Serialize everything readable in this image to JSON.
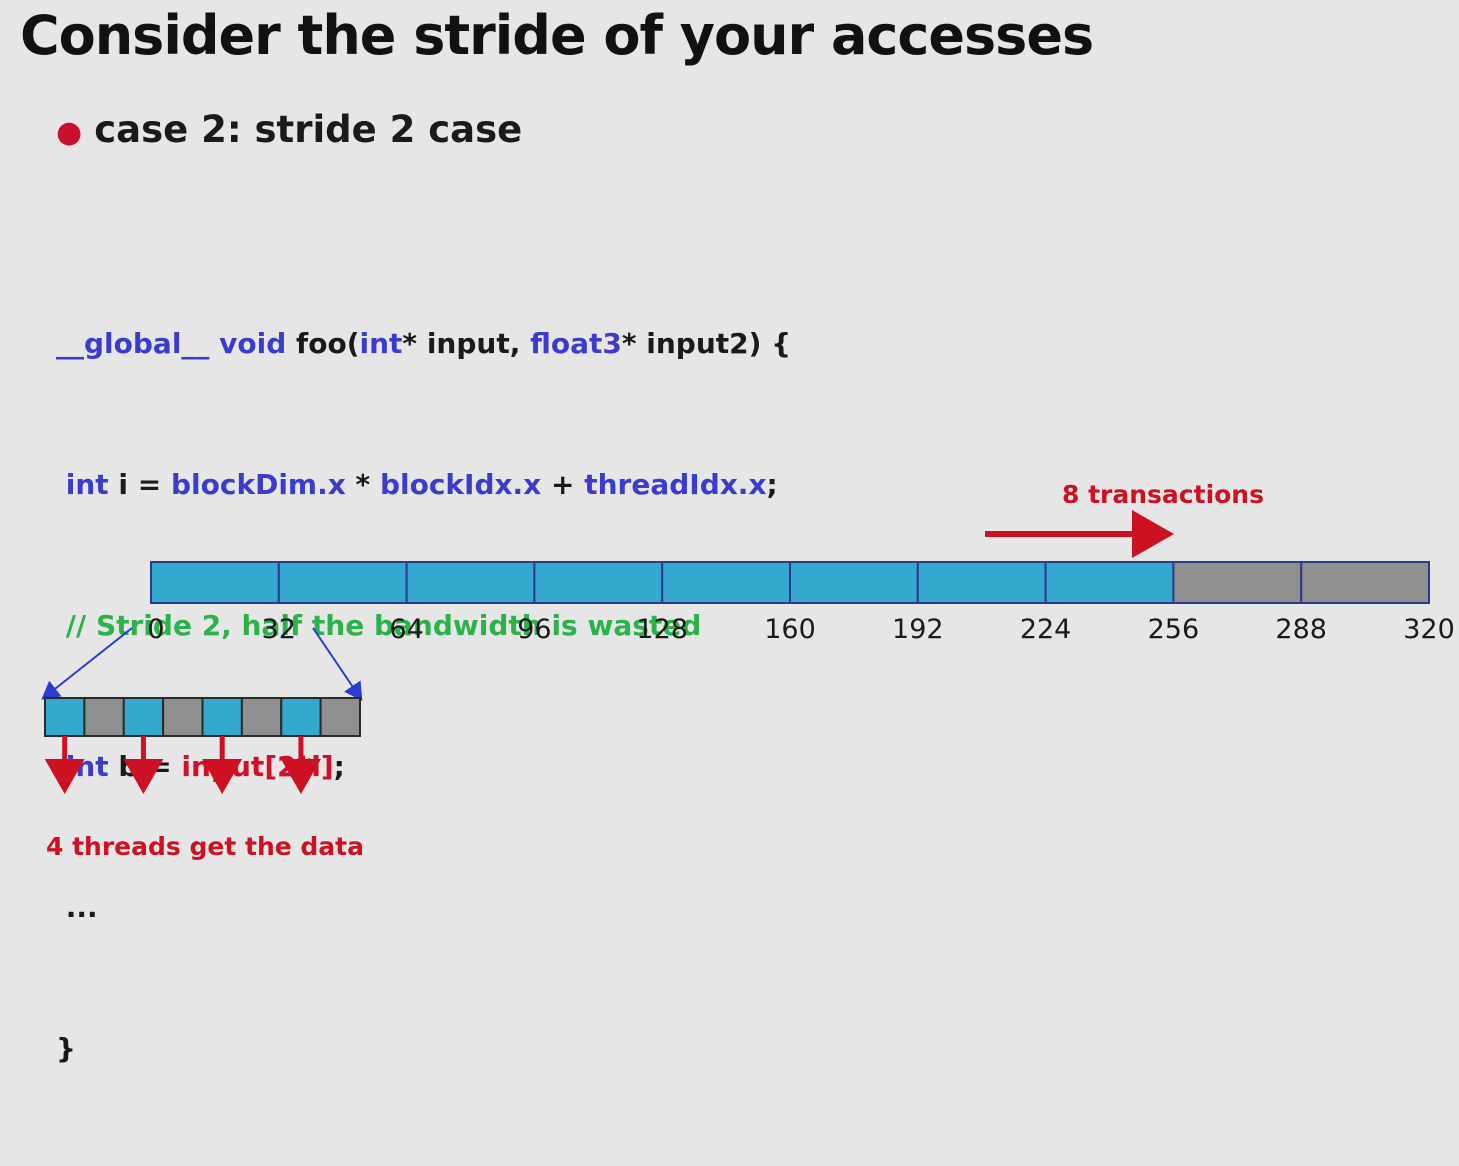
{
  "title": "Consider the stride of your accesses",
  "bullet": "case 2: stride 2 case",
  "code": {
    "l1": {
      "a": "__global__ void",
      "b": " foo(",
      "c": "int",
      "d": "* input, ",
      "e": "float3",
      "f": "* input2) {"
    },
    "l2": {
      "a": " int",
      "b": " i = ",
      "c": "blockDim.x",
      "d": " * ",
      "e": "blockIdx.x",
      "f": " + ",
      "g": "threadIdx.x",
      "h": ";"
    },
    "l3": " // Stride 2, half the bandwidth is wasted",
    "l4": {
      "a": " int",
      "b": " b = ",
      "c": "input[2*i]",
      "d": ";"
    },
    "l5": " ...",
    "l6": "}"
  },
  "memory_bar": {
    "tick_labels": [
      "0",
      "32",
      "64",
      "96",
      "128",
      "160",
      "192",
      "224",
      "256",
      "288",
      "320"
    ],
    "cells": [
      "blue",
      "blue",
      "blue",
      "blue",
      "blue",
      "blue",
      "blue",
      "blue",
      "gray",
      "gray"
    ]
  },
  "transactions_label": "8 transactions",
  "small_bar": {
    "cells": [
      "blue",
      "gray",
      "blue",
      "gray",
      "blue",
      "gray",
      "blue",
      "gray"
    ]
  },
  "threads_label": "4 threads get the data",
  "colors": {
    "blue": "#33a9cf",
    "gray": "#8f8f8f",
    "red": "#cc1122",
    "arrow_blue": "#2a3dd0",
    "outline": "#2d3a8a"
  }
}
